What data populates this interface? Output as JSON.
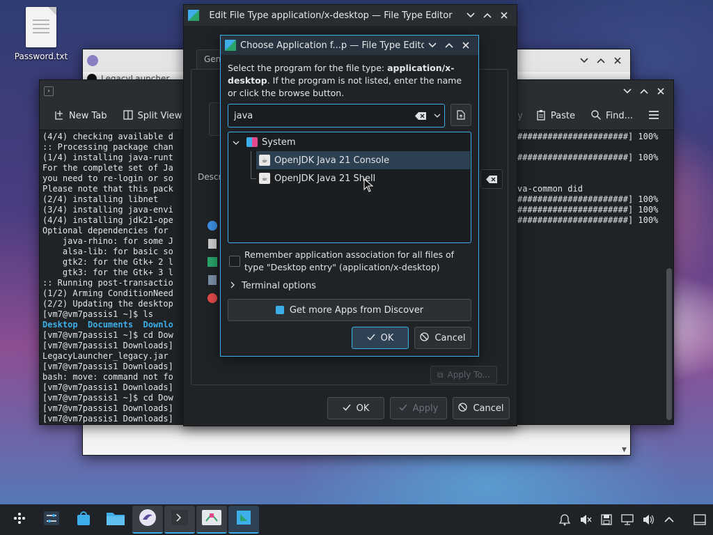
{
  "desktop": {
    "icons": [
      {
        "label": "Password.txt",
        "icon": "text-file-icon"
      }
    ]
  },
  "back_window": {
    "title": "LegacyLauncher..."
  },
  "terminal": {
    "toolbar": {
      "new_tab": "New Tab",
      "split_view": "Split View",
      "copy": "Copy",
      "paste": "Paste",
      "find": "Find..."
    },
    "left_lines": [
      "(4/4) checking available d",
      ":: Processing package chan",
      "(1/4) installing java-runt",
      "For the complete set of Ja",
      "you need to re-login or so",
      "Please note that this pack",
      "(2/4) installing libnet",
      "(3/4) installing java-envi",
      "(4/4) installing jdk21-ope",
      "Optional dependencies for ",
      "    java-rhino: for some J",
      "    alsa-lib: for basic so",
      "    gtk2: for the Gtk+ 2 l",
      "    gtk3: for the Gtk+ 3 l",
      ":: Running post-transactio",
      "(1/2) Arming ConditionNeed",
      "(2/2) Updating the desktop",
      "[vm7@vm7passis1 ~]$ ls"
    ],
    "ls_output": [
      "Desktop",
      "Documents",
      "Downlo"
    ],
    "left_lines_after": [
      "[vm7@vm7passis1 ~]$ cd Dow",
      "[vm7@vm7passis1 Downloads]",
      "LegacyLauncher_legacy.jar",
      "[vm7@vm7passis1 Downloads]",
      "bash: move: command not fo",
      "[vm7@vm7passis1 Downloads]",
      "[vm7@vm7passis1 ~]$ cd Dow",
      "[vm7@vm7passis1 Downloads]",
      "[vm7@vm7passis1 Downloads]"
    ],
    "right_lines": [
      "######################] 100%",
      "",
      "######################] 100%",
      "",
      "",
      "va-common did",
      "######################] 100%",
      "######################] 100%",
      "######################] 100%"
    ]
  },
  "file_type_editor": {
    "title": "Edit File Type application/x-desktop — File Type Editor",
    "tab_general": "Gen",
    "description_label": "Descr",
    "apply_to": "Apply To...",
    "ok": "OK",
    "apply": "Apply",
    "cancel": "Cancel"
  },
  "choose_dialog": {
    "title": "Choose Application f...p — File Type Editor",
    "desc_before": "Select the program for the file type: ",
    "desc_bold": "application/x-desktop",
    "desc_after": ". If the program is not listed, enter the name or click the browse button.",
    "search_value": "java",
    "tree": {
      "category": "System",
      "items": [
        "OpenJDK Java 21 Console",
        "OpenJDK Java 21 Shell"
      ]
    },
    "remember_label": "Remember application association for all files of type \"Desktop entry\" (application/x-desktop)",
    "remember_checked": false,
    "terminal_options": "Terminal options",
    "discover_button": "Get more Apps from Discover",
    "ok": "OK",
    "cancel": "Cancel"
  },
  "colors": {
    "accent": "#3daee9",
    "panel": "#1f2226",
    "window": "#202326"
  }
}
